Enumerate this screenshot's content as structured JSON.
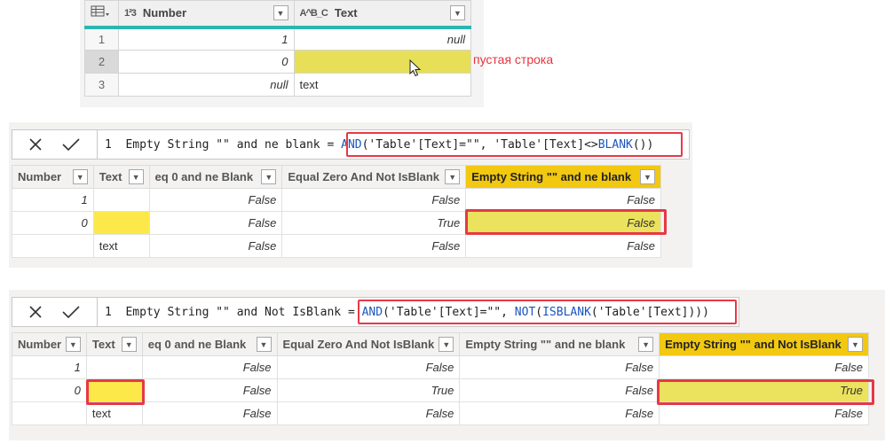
{
  "pq": {
    "col_number": {
      "type": "1²3",
      "label": "Number"
    },
    "col_text": {
      "type": "A^B_C",
      "label": "Text"
    },
    "rows": [
      {
        "index": "1",
        "number": "1",
        "text": "null"
      },
      {
        "index": "2",
        "number": "0",
        "text": ""
      },
      {
        "index": "3",
        "number": "null",
        "text": "text"
      }
    ],
    "annotation": "пустая строка"
  },
  "panel1": {
    "line": "1",
    "formula_prefix": "Empty String \"\" and ne blank = ",
    "fn_and": "AND",
    "arg1": "('Table'[Text]=\"\", 'Table'[Text]<>",
    "fn_blank": "BLANK",
    "tail": "())",
    "headers": [
      "Number",
      "Text",
      "eq 0 and ne Blank",
      "Equal Zero And Not IsBlank",
      "Empty String \"\" and ne blank"
    ],
    "rows": [
      [
        "1",
        "",
        "False",
        "False",
        "False"
      ],
      [
        "0",
        "",
        "False",
        "True",
        "False"
      ],
      [
        "",
        "text",
        "False",
        "False",
        "False"
      ]
    ]
  },
  "panel2": {
    "line": "1",
    "formula_prefix": "Empty String \"\" and Not IsBlank = ",
    "fn_and": "AND",
    "arg1": "('Table'[Text]=\"\", ",
    "fn_not": "NOT",
    "paren": "(",
    "fn_isblank": "ISBLANK",
    "tail": "('Table'[Text])))",
    "headers": [
      "Number",
      "Text",
      "eq 0 and ne Blank",
      "Equal Zero And Not IsBlank",
      "Empty String \"\" and ne blank",
      "Empty String \"\" and Not IsBlank"
    ],
    "rows": [
      [
        "1",
        "",
        "False",
        "False",
        "False",
        "False"
      ],
      [
        "0",
        "",
        "False",
        "True",
        "False",
        "True"
      ],
      [
        "",
        "text",
        "False",
        "False",
        "False",
        "False"
      ]
    ]
  },
  "colors": {
    "accent_teal": "#2bb7b1",
    "highlight_red": "#e63946",
    "selected_header": "#f2c811",
    "yellow_cell": "#fde84a"
  }
}
